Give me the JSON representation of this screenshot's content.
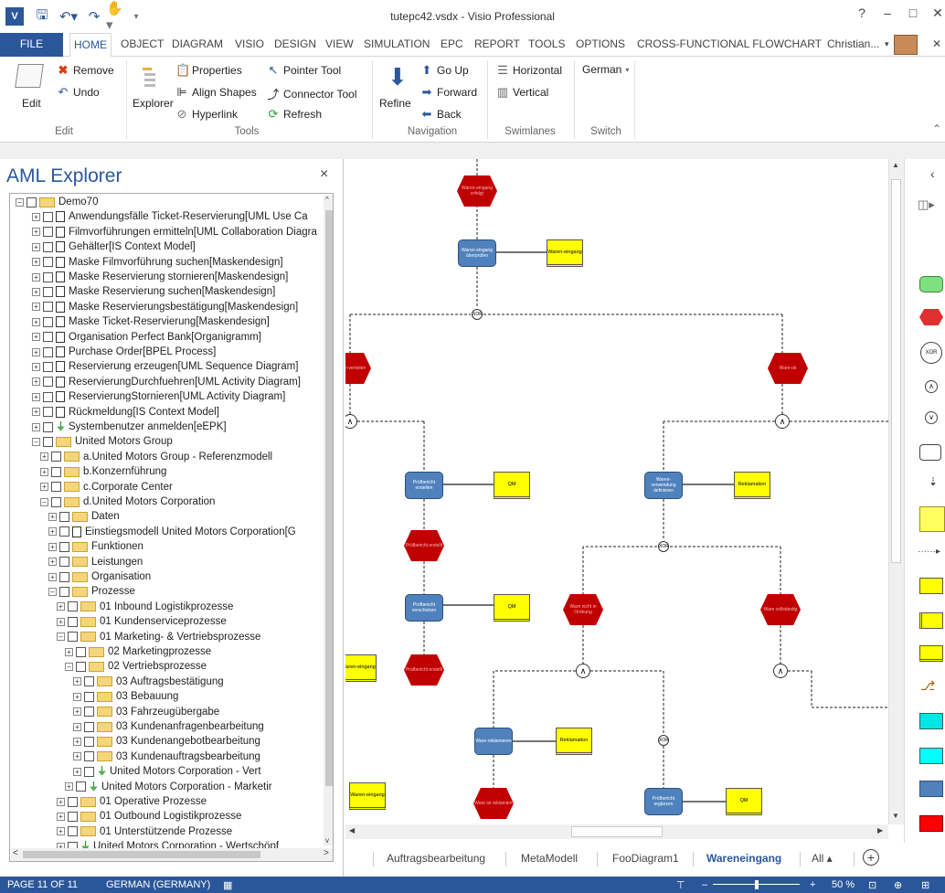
{
  "window": {
    "title": "tutepc42.vsdx - Visio Professional",
    "help": "?",
    "minimize": "–",
    "restore": "□",
    "close": "✕"
  },
  "quick_access": [
    "visio-logo-icon",
    "save-icon",
    "undo-icon",
    "redo-icon",
    "touch-mode-icon",
    "customize-icon"
  ],
  "tabs": [
    "FILE",
    "HOME",
    "OBJECT",
    "DIAGRAM",
    "VISIO",
    "DESIGN",
    "VIEW",
    "SIMULATION",
    "EPC",
    "REPORT",
    "TOOLS",
    "OPTIONS",
    "CROSS-FUNCTIONAL FLOWCHART"
  ],
  "active_tab": "HOME",
  "user": "Christian...",
  "ribbon": {
    "edit": {
      "edit": "Edit",
      "remove": "Remove",
      "undo": "Undo",
      "group": "Edit"
    },
    "tools": {
      "explorer": "Explorer",
      "properties": "Properties",
      "align_shapes": "Align Shapes",
      "hyperlink": "Hyperlink",
      "pointer_tool": "Pointer Tool",
      "connector_tool": "Connector Tool",
      "refresh": "Refresh",
      "group": "Tools"
    },
    "navigation": {
      "refine": "Refine",
      "go_up": "Go Up",
      "forward": "Forward",
      "back": "Back",
      "group": "Navigation"
    },
    "swimlanes": {
      "horizontal": "Horizontal",
      "vertical": "Vertical",
      "group": "Swimlanes"
    },
    "switch": {
      "language": "German",
      "group": "Switch"
    }
  },
  "explorer": {
    "title": "AML Explorer",
    "close": "×",
    "tree": [
      {
        "label": "Demo70",
        "indent": 0,
        "icon": "folder"
      },
      {
        "label": "Anwendungsfälle Ticket-Reservierung[UML Use Ca",
        "indent": 2,
        "icon": "doc"
      },
      {
        "label": "Filmvorführungen ermitteln[UML Collaboration Diagra",
        "indent": 2,
        "icon": "doc"
      },
      {
        "label": "Gehälter[IS Context Model]",
        "indent": 2,
        "icon": "doc"
      },
      {
        "label": "Maske Filmvorführung suchen[Maskendesign]",
        "indent": 2,
        "icon": "doc"
      },
      {
        "label": "Maske Reservierung stornieren[Maskendesign]",
        "indent": 2,
        "icon": "doc"
      },
      {
        "label": "Maske Reservierung suchen[Maskendesign]",
        "indent": 2,
        "icon": "doc"
      },
      {
        "label": "Maske Reservierungsbestätigung[Maskendesign]",
        "indent": 2,
        "icon": "doc"
      },
      {
        "label": "Maske Ticket-Reservierung[Maskendesign]",
        "indent": 2,
        "icon": "doc"
      },
      {
        "label": "Organisation Perfect Bank[Organigramm]",
        "indent": 2,
        "icon": "doc"
      },
      {
        "label": "Purchase Order[BPEL Process]",
        "indent": 2,
        "icon": "doc"
      },
      {
        "label": "Reservierung erzeugen[UML Sequence Diagram]",
        "indent": 2,
        "icon": "doc"
      },
      {
        "label": "ReservierungDurchfuehren[UML Activity Diagram]",
        "indent": 2,
        "icon": "doc"
      },
      {
        "label": "ReservierungStornieren[UML Activity Diagram]",
        "indent": 2,
        "icon": "doc"
      },
      {
        "label": "Rückmeldung[IS Context Model]",
        "indent": 2,
        "icon": "doc"
      },
      {
        "label": "Systembenutzer anmelden[eEPK]",
        "indent": 2,
        "icon": "epc"
      },
      {
        "label": "United Motors Group",
        "indent": 2,
        "icon": "folder"
      },
      {
        "label": "a.United Motors Group - Referenzmodell",
        "indent": 3,
        "icon": "folder"
      },
      {
        "label": "b.Konzernführung",
        "indent": 3,
        "icon": "folder"
      },
      {
        "label": "c.Corporate Center",
        "indent": 3,
        "icon": "folder"
      },
      {
        "label": "d.United Motors Corporation",
        "indent": 3,
        "icon": "folder"
      },
      {
        "label": "Daten",
        "indent": 4,
        "icon": "folder"
      },
      {
        "label": "Einstiegsmodell United Motors Corporation[G",
        "indent": 4,
        "icon": "doc"
      },
      {
        "label": "Funktionen",
        "indent": 4,
        "icon": "folder"
      },
      {
        "label": "Leistungen",
        "indent": 4,
        "icon": "folder"
      },
      {
        "label": "Organisation",
        "indent": 4,
        "icon": "folder"
      },
      {
        "label": "Prozesse",
        "indent": 4,
        "icon": "folder"
      },
      {
        "label": "01 Inbound Logistikprozesse",
        "indent": 5,
        "icon": "folder"
      },
      {
        "label": "01 Kundenserviceprozesse",
        "indent": 5,
        "icon": "folder"
      },
      {
        "label": "01 Marketing- & Vertriebsprozesse",
        "indent": 5,
        "icon": "folder"
      },
      {
        "label": "02 Marketingprozesse",
        "indent": 6,
        "icon": "folder"
      },
      {
        "label": "02 Vertriebsprozesse",
        "indent": 6,
        "icon": "folder"
      },
      {
        "label": "03 Auftragsbestätigung",
        "indent": 7,
        "icon": "folder"
      },
      {
        "label": "03 Bebauung",
        "indent": 7,
        "icon": "folder"
      },
      {
        "label": "03 Fahrzeugübergabe",
        "indent": 7,
        "icon": "folder"
      },
      {
        "label": "03 Kundenanfragenbearbeitung",
        "indent": 7,
        "icon": "folder"
      },
      {
        "label": "03 Kundenangebotbearbeitung",
        "indent": 7,
        "icon": "folder"
      },
      {
        "label": "03 Kundenauftragsbearbeitung",
        "indent": 7,
        "icon": "folder"
      },
      {
        "label": "United Motors Corporation - Vert",
        "indent": 7,
        "icon": "epc"
      },
      {
        "label": "United Motors Corporation - Marketir",
        "indent": 6,
        "icon": "epc"
      },
      {
        "label": "01 Operative Prozesse",
        "indent": 5,
        "icon": "folder"
      },
      {
        "label": "01 Outbound Logistikprozesse",
        "indent": 5,
        "icon": "folder"
      },
      {
        "label": "01 Unterstützende Prozesse",
        "indent": 5,
        "icon": "folder"
      },
      {
        "label": "United Motors Corporation - Wertschöpf",
        "indent": 5,
        "icon": "epc"
      }
    ]
  },
  "diagram": {
    "events": [
      "Waren-eingang erfolgt",
      "Prüfbericht erstellt",
      "Prüfbericht erstellt",
      "Ware-verteilen",
      "Ware-ok",
      "Ware nicht in Ordnung",
      "Ware vollständig",
      "Ware ist reklamiert"
    ],
    "functions": [
      "Waren-eingang überprüfen",
      "Prüfbericht erstellen",
      "Prüfbericht verschicken",
      "Waren-verwendung definieren",
      "Ware reklamieren",
      "Prüfbericht ergänzen"
    ],
    "outputs": [
      "Waren-eingang",
      "QM",
      "QM",
      "Reklamation",
      "Waren-eingang",
      "Reklamation",
      "Waren-eingang",
      "QM"
    ],
    "operators": {
      "xor": "XOR",
      "and": "∧"
    }
  },
  "page_tabs": [
    "Auftragsbearbeitung",
    "MetaModell",
    "FooDiagram1",
    "Wareneingang",
    "All ▴"
  ],
  "active_page": "Wareneingang",
  "status": {
    "page": "PAGE 11 OF 11",
    "language": "GERMAN (GERMANY)",
    "zoom": "50 %"
  }
}
